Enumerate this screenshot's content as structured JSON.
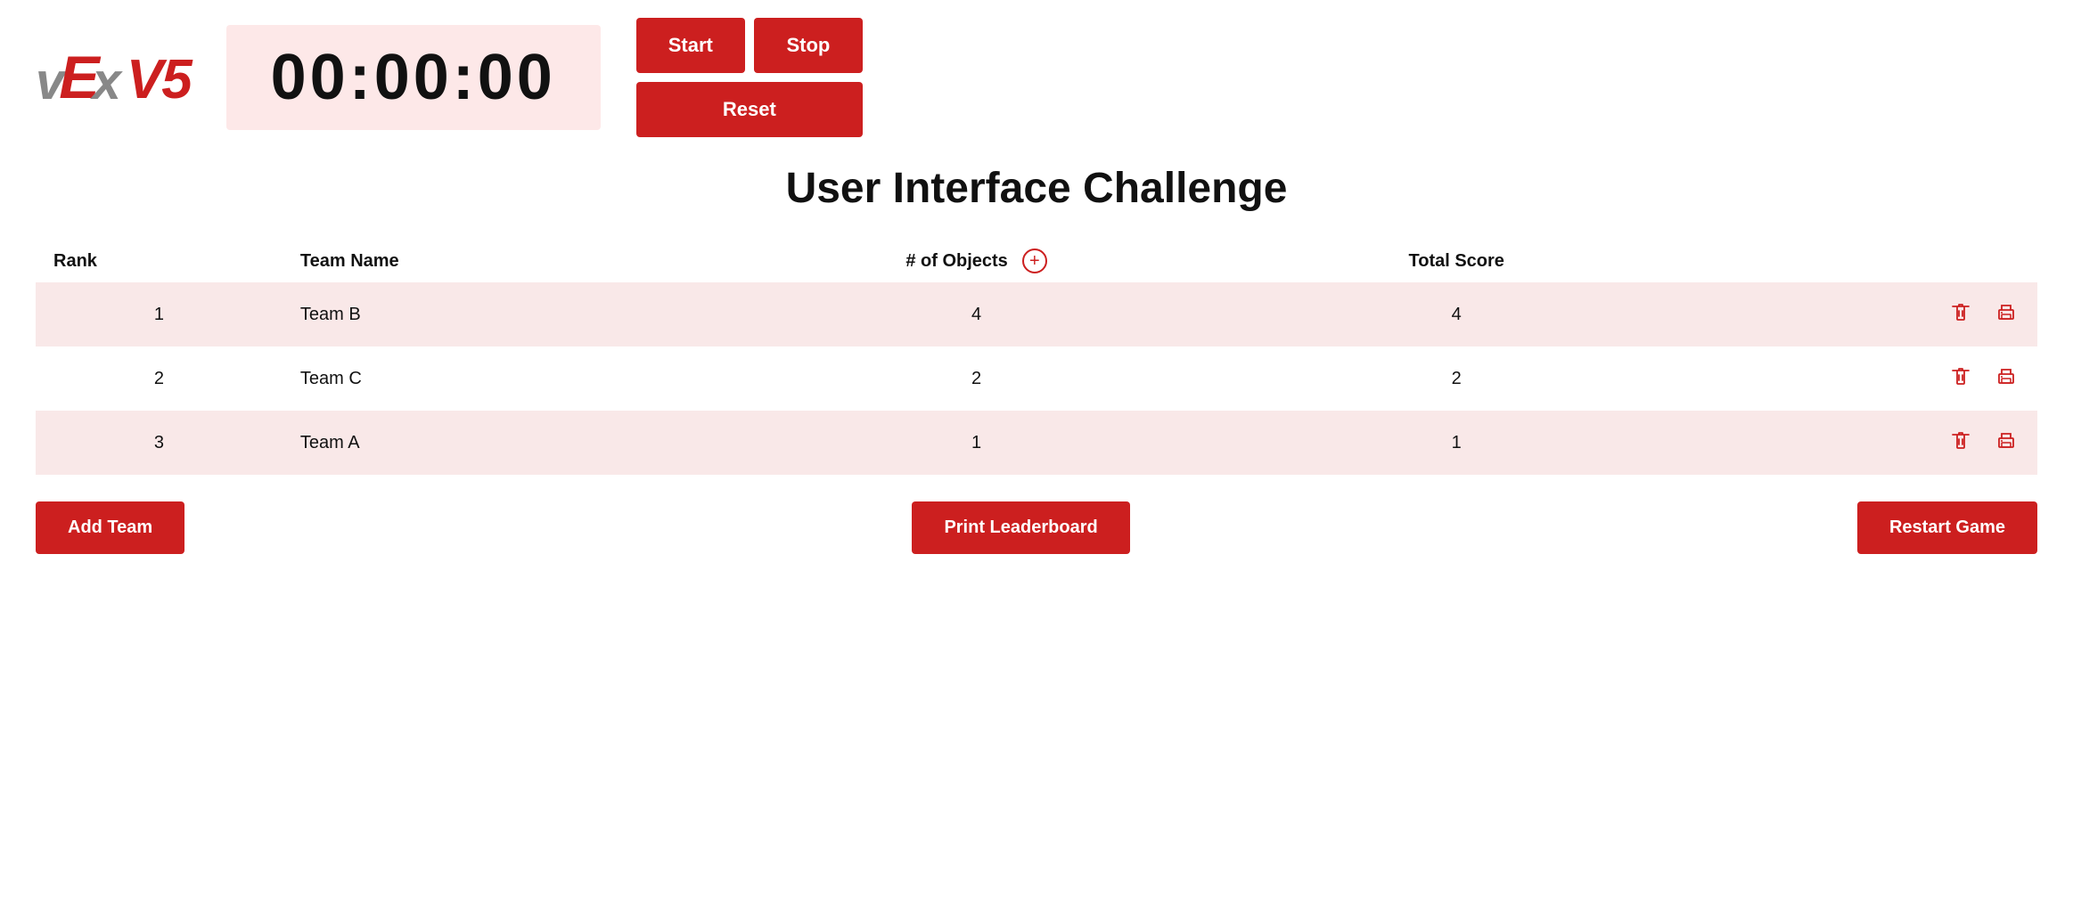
{
  "logo": {
    "alt": "VEX V5 Logo"
  },
  "timer": {
    "display": "00:00:00"
  },
  "controls": {
    "start_label": "Start",
    "stop_label": "Stop",
    "reset_label": "Reset"
  },
  "page": {
    "title": "User Interface Challenge"
  },
  "table": {
    "columns": {
      "rank": "Rank",
      "team_name": "Team Name",
      "objects": "# of Objects",
      "total_score": "Total Score"
    },
    "rows": [
      {
        "rank": 1,
        "team": "Team B",
        "objects": 4,
        "score": 4
      },
      {
        "rank": 2,
        "team": "Team C",
        "objects": 2,
        "score": 2
      },
      {
        "rank": 3,
        "team": "Team A",
        "objects": 1,
        "score": 1
      }
    ]
  },
  "footer": {
    "add_team": "Add Team",
    "print_leaderboard": "Print Leaderboard",
    "restart_game": "Restart Game"
  }
}
